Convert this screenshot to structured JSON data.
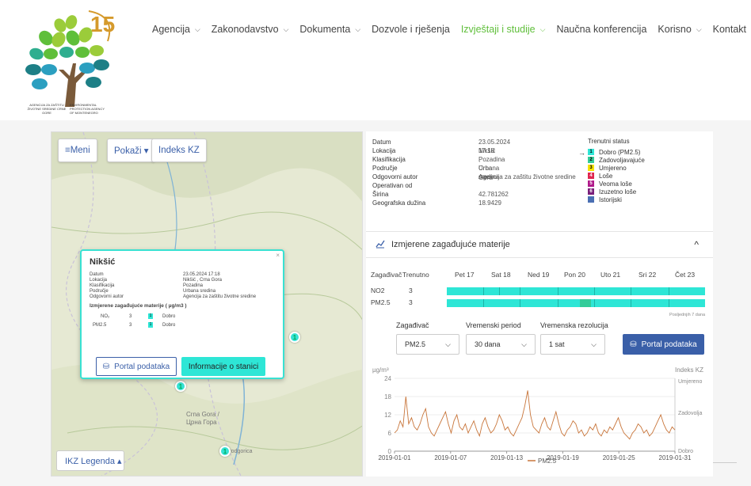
{
  "nav": {
    "items": [
      {
        "label": "Agencija",
        "active": false
      },
      {
        "label": "Zakonodavstvo",
        "active": false
      },
      {
        "label": "Dokumenta",
        "active": false
      },
      {
        "label": "Dozvole i rješenja",
        "active": false
      },
      {
        "label": "Izvještaji i studije",
        "active": true
      },
      {
        "label": "Naučna konferencija",
        "active": false
      },
      {
        "label": "Korisno",
        "active": false
      },
      {
        "label": "Kontakt",
        "active": false
      }
    ]
  },
  "logo": {
    "badge": "15",
    "left_text": "AGENCIJA ZA ZAŠTITU ŽIVOTNE SREDINE CRNE GORE",
    "right_text": "ENVIRONMENTAL PROTECTION AGENCY OF MONTENEGRO"
  },
  "map": {
    "buttons": {
      "menu": "≡Meni",
      "show": "Pokaži ▾",
      "index": "Indeks KZ"
    },
    "legend_button": "IKZ Legenda ▴",
    "labels": {
      "city1": "Crna Gora /",
      "city2": "Црна Гора",
      "city3": "Podgorica"
    },
    "markers": [
      "1",
      "1",
      "1"
    ]
  },
  "popup": {
    "title": "Nikšić",
    "rows": [
      {
        "k": "Datum",
        "v": "23.05.2024 17:18"
      },
      {
        "k": "Lokacija",
        "v": "Nikšić , Crna Gora"
      },
      {
        "k": "Klasifikacija",
        "v": "Pozadina"
      },
      {
        "k": "Područje",
        "v": "Urbana sredina"
      },
      {
        "k": "Odgovorni autor",
        "v": "Agencija za zaštitu životne sredine"
      }
    ],
    "pollutants_title": "Izmjerene zagađujuće materije ( µg/m3 )",
    "pollutants": [
      {
        "name": "NO₂",
        "value": "3",
        "index": "1",
        "label": "Dobro"
      },
      {
        "name": "PM2.5",
        "value": "3",
        "index": "1",
        "label": "Dobro"
      }
    ],
    "btn_portal": "Portal podataka",
    "btn_info": "Informacije o stanici"
  },
  "info": {
    "rows": [
      {
        "k": "Datum",
        "v": "23.05.2024 17:18"
      },
      {
        "k": "Lokacija",
        "v": "Nikšić , Crna Gora"
      },
      {
        "k": "Klasifikacija",
        "v": "Pozadina"
      },
      {
        "k": "Područje",
        "v": "Urbana sredina"
      },
      {
        "k": "Odgovorni autor",
        "v": "Agencija za zaštitu životne sredine"
      },
      {
        "k": "Operativan od",
        "v": ""
      },
      {
        "k": "Širina",
        "v": "42.781262"
      },
      {
        "k": "Geografska dužina",
        "v": "18.9429"
      }
    ]
  },
  "status": {
    "title": "Trenutni status",
    "arrow": "→",
    "items": [
      {
        "num": "1",
        "label": "Dobro (PM2.5)",
        "color": "#2ee6d6"
      },
      {
        "num": "2",
        "label": "Zadovoljavajuće",
        "color": "#33cc99"
      },
      {
        "num": "3",
        "label": "Umjereno",
        "color": "#f5e400"
      },
      {
        "num": "4",
        "label": "Loše",
        "color": "#e0254f"
      },
      {
        "num": "5",
        "label": "Veoma loše",
        "color": "#b01a8a"
      },
      {
        "num": "6",
        "label": "Izuzetno loše",
        "color": "#7a1f7a"
      },
      {
        "num": "",
        "label": "Istorijski",
        "color": "#4a6fb3"
      }
    ]
  },
  "section": {
    "title": "Izmjerene zagađujuće materije",
    "caret": "^"
  },
  "grid": {
    "headers": [
      "Zagađivač",
      "Trenutno",
      "Pet 17",
      "Sat 18",
      "Ned 19",
      "Pon 20",
      "Uto 21",
      "Sri 22",
      "Čet 23"
    ],
    "rows": [
      {
        "name": "NO2",
        "value": "3"
      },
      {
        "name": "PM2.5",
        "value": "3"
      }
    ],
    "note": "Posljednjih 7 dana"
  },
  "controls": {
    "labels": {
      "pollutant": "Zagađivač",
      "period": "Vremenski period",
      "resolution": "Vremenska rezolucija"
    },
    "values": {
      "pollutant": "PM2.5",
      "period": "30 dana",
      "resolution": "1 sat"
    },
    "portal": "Portal podataka"
  },
  "colors": {
    "accent": "#2ee6d6",
    "brand": "#3a5fa8",
    "nav_active": "#5fbf3a",
    "series": "#c8753a"
  },
  "chart_data": {
    "type": "line",
    "ylabel": "µg/m³",
    "ylabel_right": "Indeks KZ",
    "ylim": [
      0,
      24
    ],
    "yticks": [
      "0",
      "6",
      "12",
      "18",
      "24"
    ],
    "x_ticks": [
      "2019-01-01",
      "2019-01-07",
      "2019-01-13",
      "2019-01-19",
      "2019-01-25",
      "2019-01-31"
    ],
    "right_labels": [
      "Umjereno",
      "Zadovolja",
      "Dobro"
    ],
    "series": [
      {
        "name": "PM2.5",
        "values": [
          6,
          7,
          10,
          8,
          18,
          9,
          11,
          8,
          7,
          9,
          12,
          14,
          8,
          6,
          5,
          7,
          9,
          11,
          13,
          9,
          6,
          10,
          12,
          8,
          7,
          9,
          6,
          8,
          10,
          7,
          5,
          9,
          11,
          8,
          6,
          7,
          9,
          12,
          10,
          7,
          8,
          6,
          5,
          7,
          9,
          11,
          15,
          20,
          12,
          8,
          7,
          6,
          9,
          11,
          8,
          7,
          10,
          13,
          9,
          6,
          5,
          7,
          8,
          10,
          9,
          6,
          7,
          5,
          6,
          8,
          7,
          9,
          6,
          5,
          7,
          6,
          8,
          7,
          9,
          11,
          8,
          6,
          5,
          4,
          6,
          7,
          9,
          8,
          6,
          7,
          5,
          6,
          8,
          10,
          12,
          9,
          7,
          6,
          8,
          7
        ]
      }
    ]
  }
}
